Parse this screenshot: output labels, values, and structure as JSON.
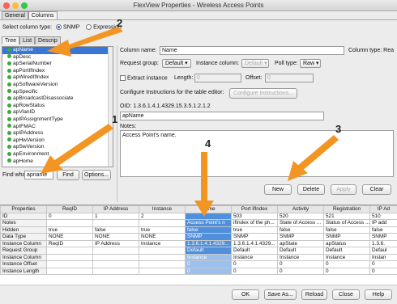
{
  "window": {
    "title": "FlexView Properties - Wireless Access Points"
  },
  "tabs": [
    {
      "label": "General"
    },
    {
      "label": "Columns"
    }
  ],
  "column_type": {
    "label": "Select column type:",
    "options": [
      "SNMP",
      "Expression"
    ],
    "selected": "SNMP"
  },
  "tree_tabs": [
    {
      "label": "Tree"
    },
    {
      "label": "List"
    },
    {
      "label": "Descrip"
    }
  ],
  "tree": {
    "items": [
      "apName",
      "apDesc",
      "apSerialNumber",
      "apPortIfIndex",
      "apWiredIfIndex",
      "apSoftwareVersion",
      "apSpecific",
      "apBroadcastDisassociate",
      "apRowStatus",
      "apVlanID",
      "apIPAssignmentType",
      "apIFMAC",
      "apIPAddress",
      "apHwVersion",
      "apSwVersion",
      "apEnvironment",
      "apHome"
    ],
    "selected_index": 0
  },
  "find": {
    "label": "Find what:",
    "value": "apname",
    "find_button": "Find",
    "options_button": "Options..."
  },
  "form": {
    "column_name_label": "Column name:",
    "column_name_value": "Name",
    "column_type_label": "Column type: Rea",
    "request_group_label": "Request group:",
    "request_group_value": "Default",
    "instance_column_label": "Instance column:",
    "instance_column_value": "Default",
    "poll_type_label": "Poll type:",
    "poll_type_value": "Raw",
    "extract_instance_label": "Extract instance",
    "length_label": "Length:",
    "length_value": "0",
    "offset_label": "Offset:",
    "offset_value": "0",
    "configure_label": "Configure Instructions for the table editor:",
    "configure_button": "Configure Instructions...",
    "oid_label": "OID:",
    "oid_value": "1.3.6.1.4.1.4329.15.3.5.1.2.1.2",
    "oid_name": "apName",
    "notes_label": "Notes:",
    "notes_value": "Access Point's name."
  },
  "actions": {
    "new": "New",
    "delete": "Delete",
    "apply": "Apply",
    "clear": "Clear"
  },
  "grid": {
    "headers": [
      "Properties",
      "ReqID",
      "IP Address",
      "Instance",
      "Name",
      "Port ifIndex",
      "Activity",
      "Registration",
      "IP Ad"
    ],
    "rows": [
      [
        "ID",
        "0",
        "1",
        "2",
        "",
        "503",
        "520",
        "521",
        "510"
      ],
      [
        "Notes",
        "",
        "",
        "",
        "Access Point's n",
        "ifIndex of the ph...",
        "State of Access ...",
        "Status of Access ...",
        "IP add"
      ],
      [
        "Hidden",
        "true",
        "false",
        "true",
        "false",
        "true",
        "false",
        "false",
        "false"
      ],
      [
        "Data Type",
        "NONE",
        "NONE",
        "NONE",
        "SNMP",
        "SNMP",
        "SNMP",
        "SNMP",
        "SNMP"
      ],
      [
        "Instance Column",
        "ReqID",
        "IP Address",
        "Instance",
        "1.3.6.1.4.1.4329...",
        "1.3.6.1.4.1.4329...",
        "apState",
        "apStatus",
        "1.3.6."
      ],
      [
        "Request Group",
        "",
        "",
        "",
        "Default",
        "Default",
        "Default",
        "Default",
        "Defaul"
      ],
      [
        "Instance Column",
        "",
        "",
        "",
        "Instance",
        "Instance",
        "Instance",
        "Instance",
        "Instan"
      ],
      [
        "Instance Offset",
        "",
        "",
        "",
        "0",
        "0",
        "0",
        "0",
        "0"
      ],
      [
        "Instance Length",
        "",
        "",
        "",
        "0",
        "0",
        "0",
        "0",
        "0"
      ]
    ]
  },
  "footer": {
    "ok": "OK",
    "save_as": "Save As...",
    "reload": "Reload",
    "close": "Close",
    "help": "Help"
  },
  "annotations": [
    {
      "label": "1"
    },
    {
      "label": "2"
    },
    {
      "label": "3"
    },
    {
      "label": "4"
    }
  ],
  "colors": {
    "accent": "#3a76d6",
    "arrow": "#f39523",
    "highlight": "#4f8fdc"
  }
}
